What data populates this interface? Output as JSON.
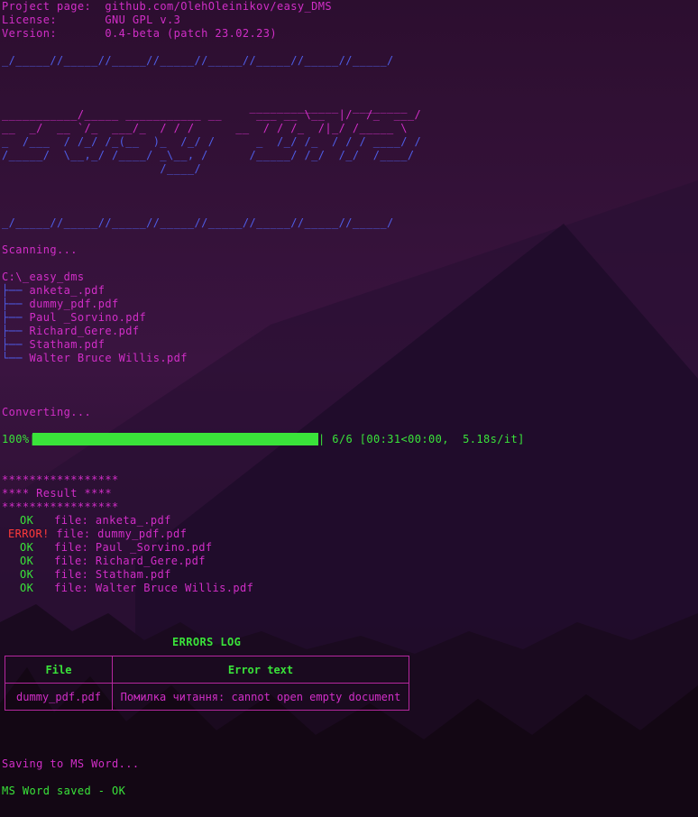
{
  "header": {
    "project_label": "Project page:",
    "project_value": "github.com/OlehOleinikov/easy_DMS",
    "license_label": "License:",
    "license_value": "GNU GPL v.3",
    "version_label": "Version:",
    "version_value": "0.4-beta (patch 23.02.23)"
  },
  "divider": "_/_____//_____//_____//_____//_____//_____//_____//_____/",
  "ascii_logo": [
    "                                    _____________  ________",
    "___________/_____ ___________ __     ___ __ \\__  |/  /_  ___/",
    "__  _/  __ `/_  ___/_  / / /      __  / / /_  /|_/ /_____ \\",
    "_  /___  / /_/ /_(__  )_  /_/ /      _  /_/ /_  / / / ____/ /",
    "/_____/  \\__,_/ /____/ _\\__, /      /_____/ /_/  /_/  /____/",
    "                       /____/"
  ],
  "scanning": "Scanning...",
  "tree": {
    "root": "C:\\_easy_dms",
    "files": [
      {
        "branch": "├──",
        "name": "anketa_.pdf"
      },
      {
        "branch": "├──",
        "name": "dummy_pdf.pdf"
      },
      {
        "branch": "├──",
        "name": "Paul _Sorvino.pdf"
      },
      {
        "branch": "├──",
        "name": "Richard_Gere.pdf"
      },
      {
        "branch": "├──",
        "name": "Statham.pdf"
      },
      {
        "branch": "└──",
        "name": "Walter Bruce Willis.pdf"
      }
    ]
  },
  "converting": "Converting...",
  "progress": {
    "percent_label": "100%|",
    "fraction": 1.0,
    "status": "| 6/6 [00:31<00:00,  5.18s/it]"
  },
  "result": {
    "stars": "*****************",
    "title": "**** Result ****",
    "rows": [
      {
        "status": "OK",
        "ok": true,
        "text": "file: anketa_.pdf"
      },
      {
        "status": "ERROR!",
        "ok": false,
        "text": "file: dummy_pdf.pdf"
      },
      {
        "status": "OK",
        "ok": true,
        "text": "file: Paul _Sorvino.pdf"
      },
      {
        "status": "OK",
        "ok": true,
        "text": "file: Richard_Gere.pdf"
      },
      {
        "status": "OK",
        "ok": true,
        "text": "file: Statham.pdf"
      },
      {
        "status": "OK",
        "ok": true,
        "text": "file: Walter Bruce Willis.pdf"
      }
    ]
  },
  "errors_log": {
    "title": "ERRORS LOG",
    "headers": [
      "File",
      "Error text"
    ],
    "rows": [
      {
        "file": "dummy_pdf.pdf",
        "error": "Помилка читання: cannot open empty document"
      }
    ]
  },
  "saving": "Saving to MS Word...",
  "saved": "MS Word saved - OK",
  "colors": {
    "magenta": "#d12ec7",
    "blue": "#4f5ee8",
    "green": "#3ae33a",
    "red": "#ff3a3a"
  }
}
